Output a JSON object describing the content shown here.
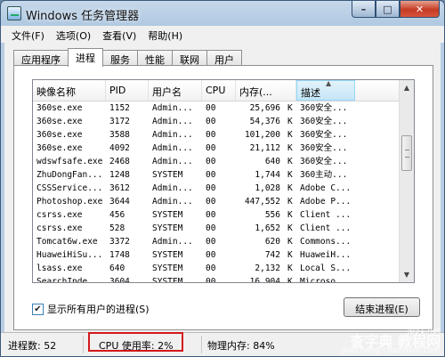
{
  "window": {
    "title": "Windows 任务管理器"
  },
  "menu": [
    "文件(F)",
    "选项(O)",
    "查看(V)",
    "帮助(H)"
  ],
  "tabs": [
    "应用程序",
    "进程",
    "服务",
    "性能",
    "联网",
    "用户"
  ],
  "active_tab": "进程",
  "columns": [
    "映像名称",
    "PID",
    "用户名",
    "CPU",
    "内存(...",
    "描述"
  ],
  "rows": [
    {
      "name": "360se.exe",
      "pid": "1152",
      "user": "Admin...",
      "cpu": "00",
      "mem": "25,696",
      "desc": "360安全..."
    },
    {
      "name": "360se.exe",
      "pid": "3172",
      "user": "Admin...",
      "cpu": "00",
      "mem": "54,376",
      "desc": "360安全..."
    },
    {
      "name": "360se.exe",
      "pid": "3588",
      "user": "Admin...",
      "cpu": "00",
      "mem": "101,200",
      "desc": "360安全..."
    },
    {
      "name": "360se.exe",
      "pid": "4092",
      "user": "Admin...",
      "cpu": "00",
      "mem": "21,112",
      "desc": "360安全..."
    },
    {
      "name": "wdswfsafe.exe",
      "pid": "2468",
      "user": "Admin...",
      "cpu": "00",
      "mem": "640",
      "desc": "360安全..."
    },
    {
      "name": "ZhuDongFan...",
      "pid": "1248",
      "user": "SYSTEM",
      "cpu": "00",
      "mem": "1,744",
      "desc": "360主动..."
    },
    {
      "name": "CSSService...",
      "pid": "3612",
      "user": "Admin...",
      "cpu": "00",
      "mem": "1,028",
      "desc": "Adobe C..."
    },
    {
      "name": "Photoshop.exe",
      "pid": "3644",
      "user": "Admin...",
      "cpu": "00",
      "mem": "447,552",
      "desc": "Adobe P..."
    },
    {
      "name": "csrss.exe",
      "pid": "456",
      "user": "SYSTEM",
      "cpu": "00",
      "mem": "556",
      "desc": "Client ..."
    },
    {
      "name": "csrss.exe",
      "pid": "528",
      "user": "SYSTEM",
      "cpu": "00",
      "mem": "1,652",
      "desc": "Client ..."
    },
    {
      "name": "Tomcat6w.exe",
      "pid": "3372",
      "user": "Admin...",
      "cpu": "00",
      "mem": "620",
      "desc": "Commons..."
    },
    {
      "name": "HuaweiHiSu...",
      "pid": "1748",
      "user": "SYSTEM",
      "cpu": "00",
      "mem": "742",
      "desc": "HuaweiH..."
    },
    {
      "name": "lsass.exe",
      "pid": "640",
      "user": "SYSTEM",
      "cpu": "00",
      "mem": "2,132",
      "desc": "Local S..."
    },
    {
      "name": "SearchInde...",
      "pid": "3604",
      "user": "SYSTEM",
      "cpu": "00",
      "mem": "16,904",
      "desc": "Microso..."
    }
  ],
  "mem_unit": "K",
  "show_all_label": "显示所有用户的进程(S)",
  "end_process_label": "结束进程(E)",
  "status": {
    "processes": "进程数: 52",
    "cpu_usage": "CPU 使用率: 2%",
    "memory": "物理内存: 84%"
  },
  "watermark": {
    "line1": "jb51.net",
    "line2": "查字典 教程网",
    "line3": "jiaocheng.chazidian.com"
  },
  "colors": {
    "highlight_border": "#d4181a",
    "title_bg": "#b8cde4"
  }
}
